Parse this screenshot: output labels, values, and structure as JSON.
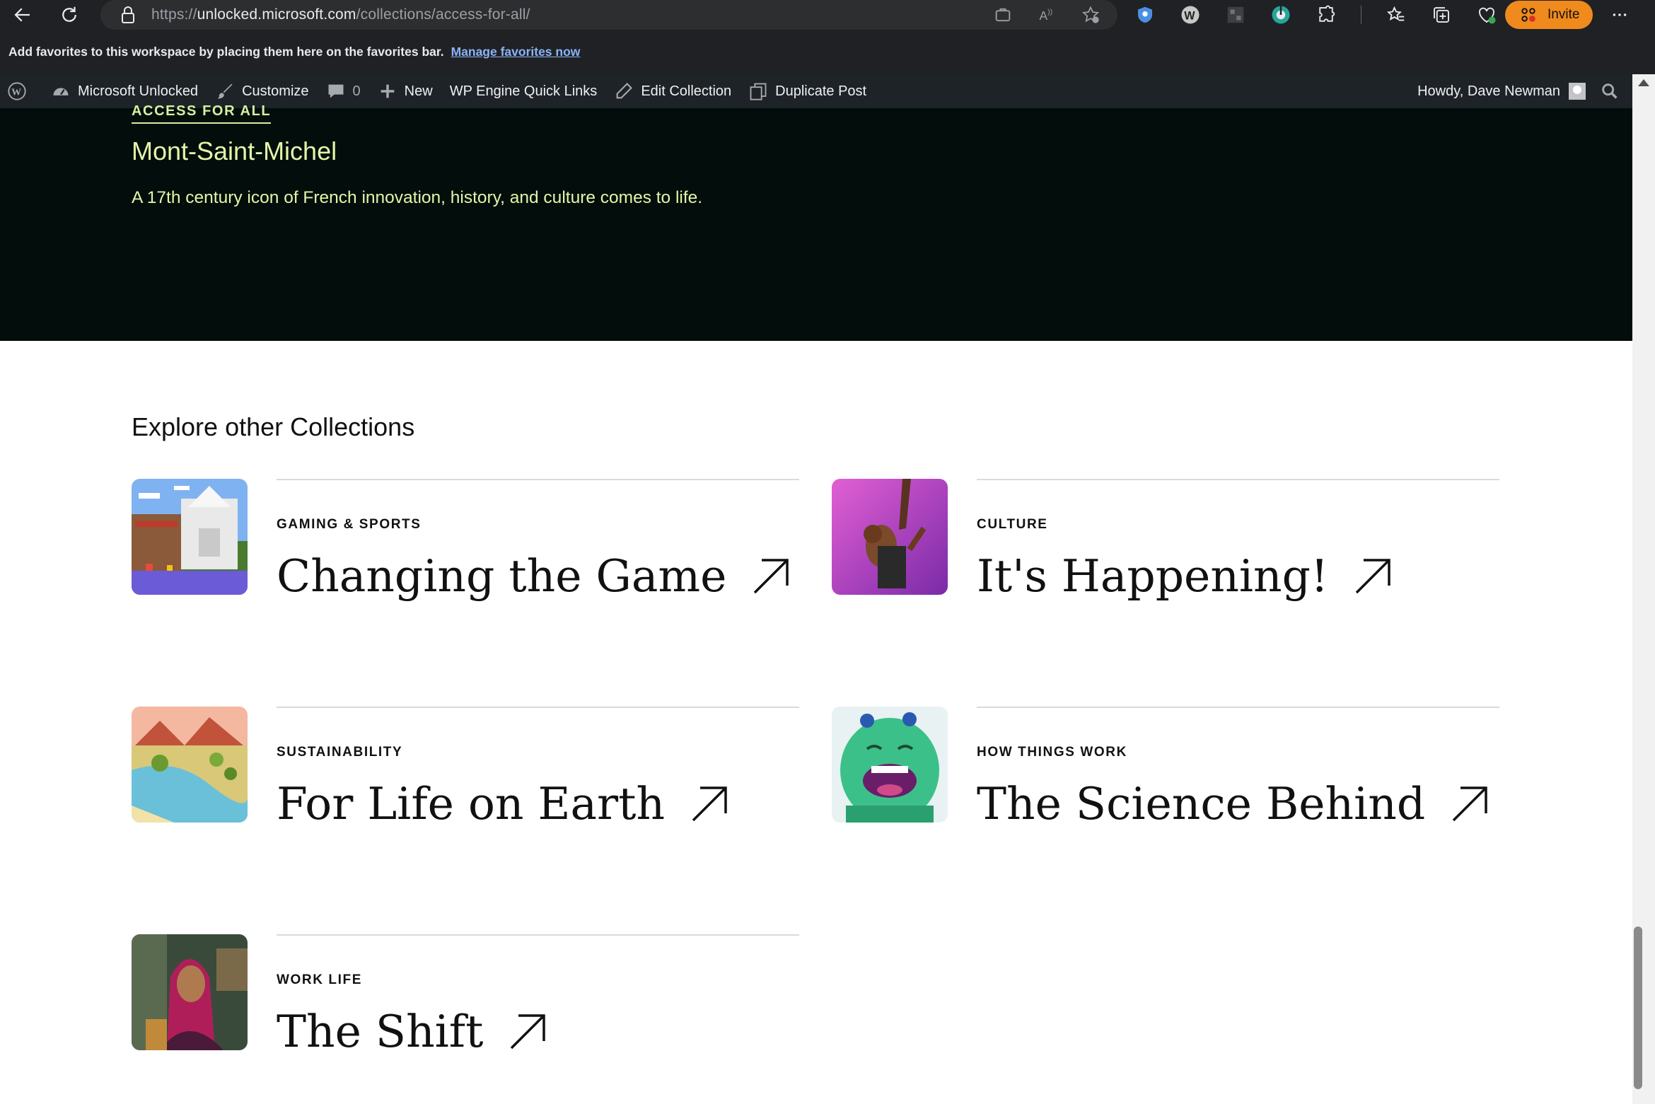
{
  "browser": {
    "url_prefix": "https://",
    "url_host": "unlocked.microsoft.com",
    "url_path": "/collections/access-for-all/",
    "invite_label": "Invite"
  },
  "favorites_bar": {
    "message": "Add favorites to this workspace by placing them here on the favorites bar.",
    "manage_link": "Manage favorites now"
  },
  "wp_admin_bar": {
    "site_name": "Microsoft Unlocked",
    "customize": "Customize",
    "comments_count": "0",
    "new": "New",
    "quick_links": "WP Engine Quick Links",
    "edit_collection": "Edit Collection",
    "duplicate_post": "Duplicate Post",
    "howdy": "Howdy, Dave Newman"
  },
  "hero": {
    "eyebrow": "ACCESS FOR ALL",
    "title": "Mont-Saint-Michel",
    "description": "A 17th century icon of French innovation, history, and culture comes to life."
  },
  "collections": {
    "heading": "Explore other Collections",
    "items": [
      {
        "category": "GAMING & SPORTS",
        "title": "Changing the Game",
        "thumb": "minecraft-castle-image"
      },
      {
        "category": "CULTURE",
        "title": "It's Happening!",
        "thumb": "dancer-image"
      },
      {
        "category": "SUSTAINABILITY",
        "title": "For Life on Earth",
        "thumb": "lowpoly-landscape-image"
      },
      {
        "category": "HOW THINGS WORK",
        "title": "The Science Behind",
        "thumb": "green-monster-image"
      },
      {
        "category": "WORK LIFE",
        "title": "The Shift",
        "thumb": "woman-portrait-image"
      }
    ]
  },
  "colors": {
    "hero_bg": "#030d0b",
    "hero_text": "#e4f6a8",
    "invite_button": "#f08a1c",
    "admin_bar": "#1d2327"
  }
}
